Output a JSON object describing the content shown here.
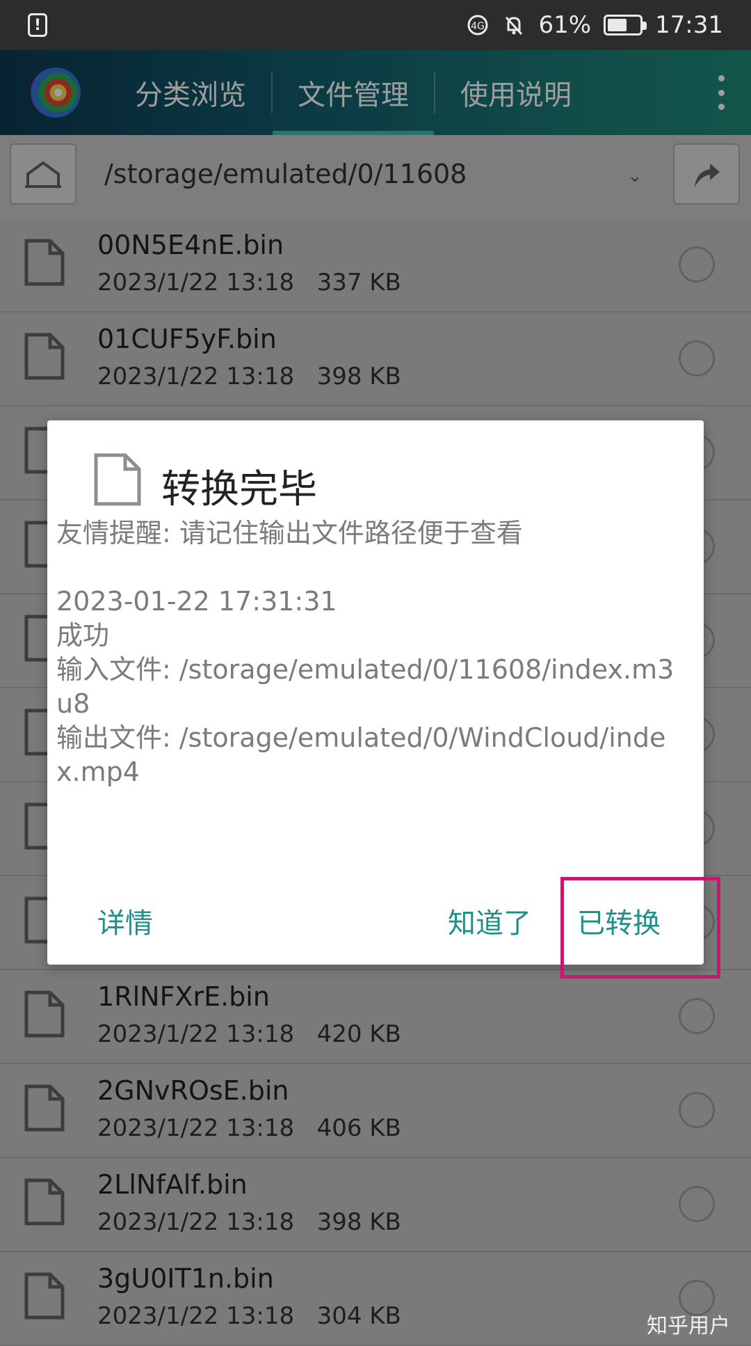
{
  "status_bar": {
    "notification_icon": "alert-clipboard-icon",
    "icons": [
      "data-saver-icon",
      "silent-bell-icon"
    ],
    "battery_percent": "61%",
    "battery_level": 0.61,
    "time": "17:31"
  },
  "header": {
    "logo": "app-logo-icon",
    "tabs": [
      {
        "label": "分类浏览",
        "active": false
      },
      {
        "label": "文件管理",
        "active": true
      },
      {
        "label": "使用说明",
        "active": false
      }
    ],
    "overflow": "more-vertical-icon"
  },
  "path_bar": {
    "home_icon": "home-icon",
    "path": "/storage/emulated/0/11608",
    "dropdown_icon": "chevron-down-icon",
    "up_icon": "up-arrow-icon"
  },
  "files": [
    {
      "name": "00N5E4nE.bin",
      "date": "2023/1/22 13:18",
      "size": "337 KB"
    },
    {
      "name": "01CUF5yF.bin",
      "date": "2023/1/22 13:18",
      "size": "398 KB"
    },
    {
      "name": "",
      "date": "",
      "size": ""
    },
    {
      "name": "",
      "date": "",
      "size": ""
    },
    {
      "name": "",
      "date": "",
      "size": ""
    },
    {
      "name": "",
      "date": "",
      "size": ""
    },
    {
      "name": "",
      "date": "",
      "size": ""
    },
    {
      "name": "",
      "date": "",
      "size": ""
    },
    {
      "name": "1RlNFXrE.bin",
      "date": "2023/1/22 13:18",
      "size": "420 KB"
    },
    {
      "name": "2GNvROsE.bin",
      "date": "2023/1/22 13:18",
      "size": "406 KB"
    },
    {
      "name": "2LlNfAlf.bin",
      "date": "2023/1/22 13:18",
      "size": "398 KB"
    },
    {
      "name": "3gU0IT1n.bin",
      "date": "2023/1/22 13:18",
      "size": "304 KB"
    }
  ],
  "dialog": {
    "title": "转换完毕",
    "reminder": "友情提醒: 请记住输出文件路径便于查看",
    "timestamp": "2023-01-22 17:31:31",
    "result": "成功",
    "input_file": "输入文件: /storage/emulated/0/11608/index.m3u8",
    "output_file": "输出文件: /storage/emulated/0/WindCloud/index.mp4",
    "buttons": {
      "details": "详情",
      "ok": "知道了",
      "converted": "已转换"
    }
  },
  "watermark": "知乎用户"
}
